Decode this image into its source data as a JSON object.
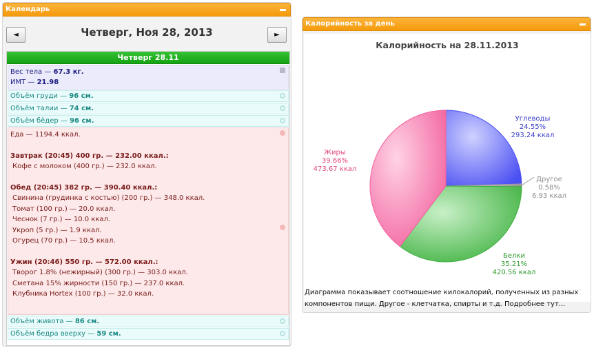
{
  "calendar": {
    "title": "Календарь",
    "prev_label": "◄",
    "next_label": "►",
    "date_title": "Четверг, Ноя 28, 2013",
    "day_header": "Четверг 28.11",
    "weight": {
      "label": "Вес тела — ",
      "value": "67.3 кг."
    },
    "bmi": {
      "label": "ИМТ — ",
      "value": "21.98"
    },
    "measures_top": [
      {
        "label": "Объём груди — ",
        "value": "96 см."
      },
      {
        "label": "Объём талии — ",
        "value": "74 см."
      },
      {
        "label": "Объём бёдер — ",
        "value": "96 см."
      }
    ],
    "food": {
      "total": "Еда — 1194.4 ккал.",
      "meals": [
        {
          "title": "Завтрак (20:45) 400 гр. — 232.00 ккал.:",
          "items": [
            "Кофе с молоком (400 гр.) — 232.0 ккал."
          ]
        },
        {
          "title": "Обед (20:45) 382 гр. — 390.40 ккал.:",
          "items": [
            "Свинина (грудинка с костью) (200 гр.) — 348.0 ккал.",
            "Томат (100 гр.) — 20.0 ккал.",
            "Чеснок (7 гр.) — 10.0 ккал.",
            "Укроп (5 гр.) — 1.9 ккал.",
            "Огурец (70 гр.) — 10.5 ккал."
          ]
        },
        {
          "title": "Ужин (20:46) 550 гр. — 572.00 ккал.:",
          "items": [
            "Творог 1.8% (нежирный) (300 гр.) — 303.0 ккал.",
            "Сметана 15% жирности (150 гр.) — 237.0 ккал.",
            "Клубника Hortex (100 гр.) — 32.0 ккал."
          ]
        }
      ]
    },
    "measures_bottom": [
      {
        "label": "Объём живота — ",
        "value": "86 см."
      },
      {
        "label": "Объём бедра вверху — ",
        "value": "59 см."
      }
    ]
  },
  "calories_panel": {
    "title": "Калорийность за день",
    "description": "Диаграмма показывает соотношение килокалорий, полученных из разных компонентов пищи. Другое - клетчатка, спирты и т.д. Подробнее тут..."
  },
  "chart_data": {
    "type": "pie",
    "title": "Калорийность на 28.11.2013",
    "slices": [
      {
        "name": "Углеводы",
        "percent": 24.55,
        "value": 293.24,
        "value_label": "24.55%",
        "kcal_label": "293.24 ккал",
        "color": "#4a4ff2",
        "label_color": "#3b3fc9"
      },
      {
        "name": "Другое",
        "percent": 0.58,
        "value": 6.93,
        "value_label": "0.58%",
        "kcal_label": "6.93 ккал",
        "color": "#9a9a9a",
        "label_color": "#8c8c8c"
      },
      {
        "name": "Белки",
        "percent": 35.21,
        "value": 420.56,
        "value_label": "35.21%",
        "kcal_label": "420.56 ккал",
        "color": "#3cb03c",
        "label_color": "#2e9a2e"
      },
      {
        "name": "Жиры",
        "percent": 39.66,
        "value": 473.67,
        "value_label": "39.66%",
        "kcal_label": "473.67 ккал",
        "color": "#f25f9c",
        "label_color": "#e0457f"
      }
    ]
  }
}
